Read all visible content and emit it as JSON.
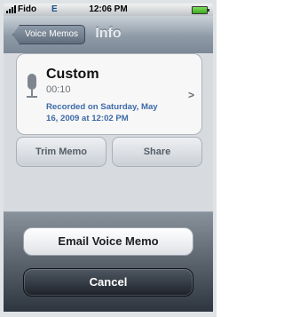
{
  "status": {
    "carrier": "Fido",
    "network": "E",
    "time": "12:06 PM",
    "battery_icon": "battery-icon",
    "signal_icon": "signal-bars-icon"
  },
  "nav": {
    "back_label": "Voice Memos",
    "title": "Info"
  },
  "memo": {
    "name": "Custom",
    "duration": "00:10",
    "recorded": "Recorded on Saturday, May 16, 2009 at 12:02 PM",
    "mic_icon": "microphone-icon",
    "chevron_icon": "chevron-right-icon"
  },
  "actions": {
    "trim_label": "Trim Memo",
    "share_label": "Share"
  },
  "sheet": {
    "email_label": "Email Voice Memo",
    "cancel_label": "Cancel"
  }
}
